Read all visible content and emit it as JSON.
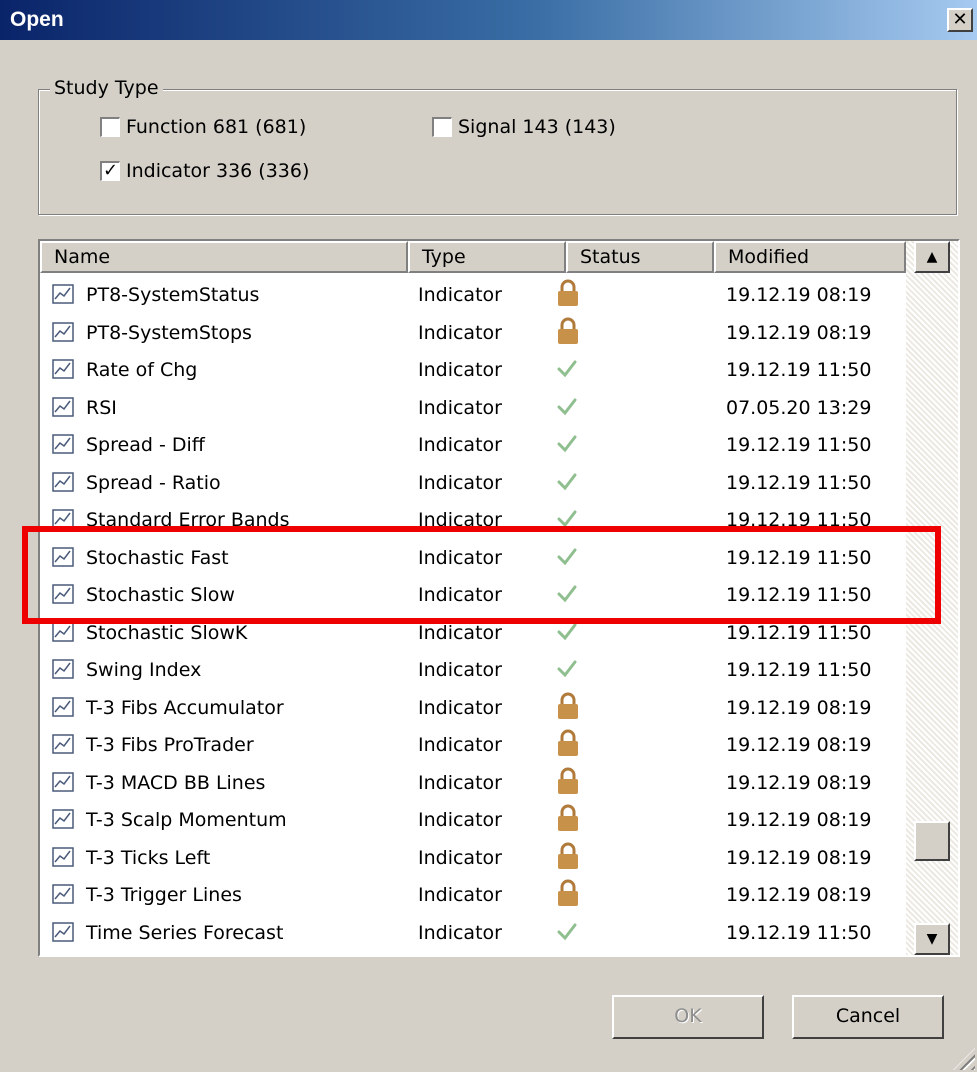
{
  "window": {
    "title": "Open"
  },
  "study_type": {
    "legend": "Study Type",
    "options": [
      {
        "label": "Function 681 (681)",
        "checked": false
      },
      {
        "label": "Signal 143 (143)",
        "checked": false
      },
      {
        "label": "Indicator 336 (336)",
        "checked": true
      }
    ]
  },
  "list": {
    "columns": [
      "Name",
      "Type",
      "Status",
      "Modified"
    ],
    "rows": [
      {
        "name": "PT8-SystemStatus",
        "type": "Indicator",
        "status": "locked",
        "modified": "19.12.19 08:19"
      },
      {
        "name": "PT8-SystemStops",
        "type": "Indicator",
        "status": "locked",
        "modified": "19.12.19 08:19"
      },
      {
        "name": "Rate of Chg",
        "type": "Indicator",
        "status": "verified",
        "modified": "19.12.19 11:50"
      },
      {
        "name": "RSI",
        "type": "Indicator",
        "status": "verified",
        "modified": "07.05.20 13:29"
      },
      {
        "name": "Spread - Diff",
        "type": "Indicator",
        "status": "verified",
        "modified": "19.12.19 11:50"
      },
      {
        "name": "Spread - Ratio",
        "type": "Indicator",
        "status": "verified",
        "modified": "19.12.19 11:50"
      },
      {
        "name": "Standard Error Bands",
        "type": "Indicator",
        "status": "verified",
        "modified": "19.12.19 11:50"
      },
      {
        "name": "Stochastic Fast",
        "type": "Indicator",
        "status": "verified",
        "modified": "19.12.19 11:50"
      },
      {
        "name": "Stochastic Slow",
        "type": "Indicator",
        "status": "verified",
        "modified": "19.12.19 11:50"
      },
      {
        "name": "Stochastic SlowK",
        "type": "Indicator",
        "status": "verified",
        "modified": "19.12.19 11:50"
      },
      {
        "name": "Swing Index",
        "type": "Indicator",
        "status": "verified",
        "modified": "19.12.19 11:50"
      },
      {
        "name": "T-3 Fibs Accumulator",
        "type": "Indicator",
        "status": "locked",
        "modified": "19.12.19 08:19"
      },
      {
        "name": "T-3 Fibs ProTrader",
        "type": "Indicator",
        "status": "locked",
        "modified": "19.12.19 08:19"
      },
      {
        "name": "T-3 MACD BB Lines",
        "type": "Indicator",
        "status": "locked",
        "modified": "19.12.19 08:19"
      },
      {
        "name": "T-3 Scalp Momentum",
        "type": "Indicator",
        "status": "locked",
        "modified": "19.12.19 08:19"
      },
      {
        "name": "T-3 Ticks Left",
        "type": "Indicator",
        "status": "locked",
        "modified": "19.12.19 08:19"
      },
      {
        "name": "T-3 Trigger Lines",
        "type": "Indicator",
        "status": "locked",
        "modified": "19.12.19 08:19"
      },
      {
        "name": "Time Series Forecast",
        "type": "Indicator",
        "status": "verified",
        "modified": "19.12.19 11:50"
      }
    ]
  },
  "buttons": {
    "ok": "OK",
    "cancel": "Cancel"
  },
  "colors": {
    "highlight": "#ee0000",
    "lock": "#c8914a",
    "check": "#8fbf8f"
  }
}
